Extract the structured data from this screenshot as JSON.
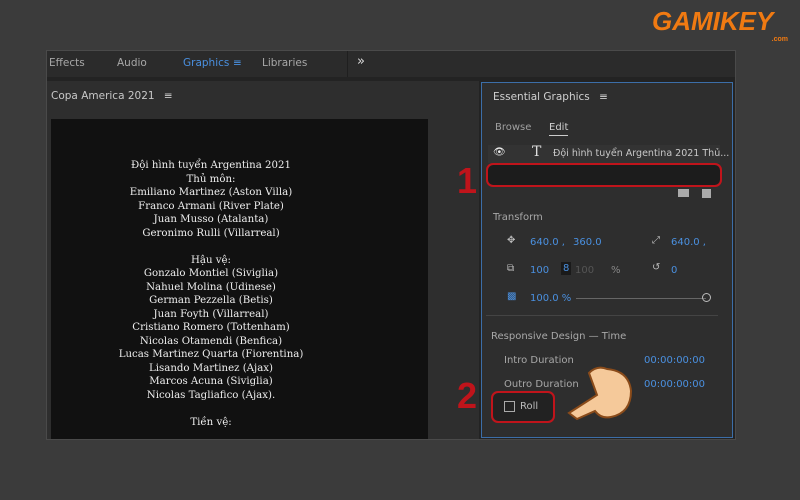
{
  "logo": {
    "text": "GAMIKEY",
    ".com": ".com",
    "suffix": ".com"
  },
  "tabs": [
    {
      "label": "Effects"
    },
    {
      "label": "Audio"
    },
    {
      "label": "Graphics"
    },
    {
      "label": "Libraries"
    }
  ],
  "tab_more": "»",
  "left_panel": {
    "title": "Copa America 2021",
    "menu": "≡"
  },
  "preview_lines": [
    "Đội hình tuyển Argentina 2021",
    "Thủ môn:",
    "Emiliano Martinez (Aston Villa)",
    "Franco Armani (River Plate)",
    "Juan Musso (Atalanta)",
    "Geronimo Rulli (Villarreal)",
    "",
    "Hậu vệ:",
    "Gonzalo Montiel (Siviglia)",
    "Nahuel Molina (Udinese)",
    "German Pezzella (Betis)",
    "Juan Foyth (Villarreal)",
    "Cristiano Romero (Tottenham)",
    "Nicolas Otamendi (Benfica)",
    "Lucas Martinez Quarta (Fiorentina)",
    "Lisando Martinez (Ajax)",
    "Marcos Acuna (Siviglia)",
    "Nicolas Tagliafico (Ajax).",
    "",
    "Tiền vệ:"
  ],
  "essential": {
    "title": "Essential Graphics",
    "menu": "≡",
    "tab_browse": "Browse",
    "tab_edit": "Edit",
    "layer_name": "Đội hình tuyển Argentina 2021 Thủ...",
    "transform_label": "Transform",
    "pos_x": "640.0 ,",
    "pos_y": "360.0",
    "anchor": "640.0 ,",
    "scale": "100",
    "scale2": "100",
    "pct": "%",
    "rotation": "0",
    "opacity": "100.0 %",
    "opacity_value": 100,
    "responsive_label": "Responsive Design — Time",
    "intro_label": "Intro Duration",
    "intro_value": "00:00:00:00",
    "outro_label": "Outro Duration",
    "outro_value": "00:00:00:00",
    "roll_label": "Roll",
    "roll_checked": false
  },
  "annotations": {
    "one": "1",
    "two": "2"
  },
  "colors": {
    "accent": "#4a90e0",
    "highlight": "#c0141b",
    "logo": "#f07a12"
  }
}
